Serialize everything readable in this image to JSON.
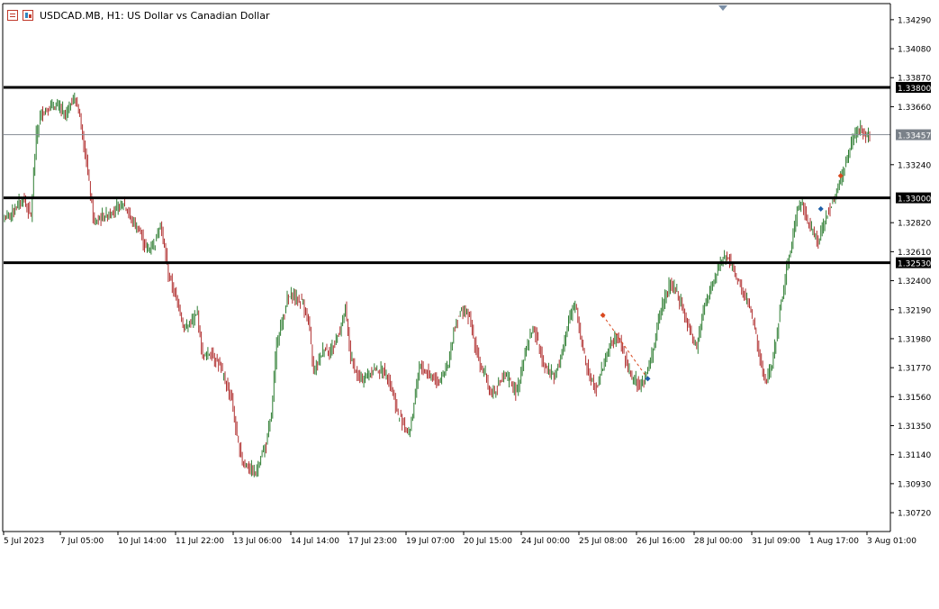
{
  "header": {
    "title": "USDCAD.MB, H1:  US Dollar vs Canadian Dollar",
    "chart_icon": "chart-window-icon",
    "trade_icon": "one-click-trading-icon"
  },
  "colors": {
    "bull": "#2e7d32",
    "bear": "#b03030",
    "axis": "#000000",
    "level_line": "#000000",
    "bid_line": "#8a9099",
    "bid_label_bg": "#7a8189",
    "buy_marker": "#d9481e",
    "sell_marker": "#1f5fa8",
    "background": "#ffffff"
  },
  "chart_data": {
    "type": "candlestick",
    "symbol": "USDCAD.MB",
    "timeframe": "H1",
    "ylim": [
      1.3059,
      1.344
    ],
    "y_ticks": [
      "1.34290",
      "1.34080",
      "1.33870",
      "1.33660",
      "1.33240",
      "1.32820",
      "1.32610",
      "1.32400",
      "1.32190",
      "1.31980",
      "1.31770",
      "1.31560",
      "1.31350",
      "1.31140",
      "1.30930",
      "1.30720"
    ],
    "x_ticks": [
      "5 Jul 2023",
      "7 Jul 05:00",
      "10 Jul 14:00",
      "11 Jul 22:00",
      "13 Jul 06:00",
      "14 Jul 14:00",
      "17 Jul 23:00",
      "19 Jul 07:00",
      "20 Jul 15:00",
      "24 Jul 00:00",
      "25 Jul 08:00",
      "26 Jul 16:00",
      "28 Jul 00:00",
      "31 Jul 09:00",
      "1 Aug 17:00",
      "3 Aug 01:00"
    ],
    "horizontal_levels": [
      {
        "price": 1.338,
        "label": "1.33800"
      },
      {
        "price": 1.33,
        "label": "1.33000"
      },
      {
        "price": 1.3253,
        "label": "1.32530"
      }
    ],
    "bid_line": {
      "price": 1.33457,
      "label": "1.33457"
    },
    "close_path": [
      [
        0,
        1.3285
      ],
      [
        8,
        1.3292
      ],
      [
        14,
        1.33
      ],
      [
        20,
        1.3287
      ],
      [
        24,
        1.3345
      ],
      [
        28,
        1.3362
      ],
      [
        34,
        1.3365
      ],
      [
        40,
        1.3367
      ],
      [
        46,
        1.336
      ],
      [
        52,
        1.3372
      ],
      [
        56,
        1.3365
      ],
      [
        60,
        1.334
      ],
      [
        64,
        1.331
      ],
      [
        68,
        1.328
      ],
      [
        72,
        1.3285
      ],
      [
        78,
        1.3288
      ],
      [
        84,
        1.3292
      ],
      [
        90,
        1.3296
      ],
      [
        96,
        1.3284
      ],
      [
        102,
        1.3276
      ],
      [
        108,
        1.3262
      ],
      [
        114,
        1.3268
      ],
      [
        118,
        1.3282
      ],
      [
        124,
        1.3245
      ],
      [
        128,
        1.3233
      ],
      [
        132,
        1.3222
      ],
      [
        136,
        1.3205
      ],
      [
        142,
        1.321
      ],
      [
        146,
        1.3216
      ],
      [
        150,
        1.3185
      ],
      [
        156,
        1.3188
      ],
      [
        162,
        1.318
      ],
      [
        166,
        1.317
      ],
      [
        172,
        1.3155
      ],
      [
        176,
        1.3125
      ],
      [
        180,
        1.311
      ],
      [
        186,
        1.3103
      ],
      [
        190,
        1.31
      ],
      [
        194,
        1.3112
      ],
      [
        198,
        1.3122
      ],
      [
        202,
        1.3142
      ],
      [
        206,
        1.3195
      ],
      [
        210,
        1.321
      ],
      [
        214,
        1.3226
      ],
      [
        218,
        1.323
      ],
      [
        222,
        1.3226
      ],
      [
        226,
        1.3224
      ],
      [
        230,
        1.321
      ],
      [
        234,
        1.3175
      ],
      [
        238,
        1.3183
      ],
      [
        242,
        1.3192
      ],
      [
        246,
        1.3188
      ],
      [
        250,
        1.3195
      ],
      [
        254,
        1.3205
      ],
      [
        258,
        1.322
      ],
      [
        262,
        1.3185
      ],
      [
        266,
        1.3173
      ],
      [
        270,
        1.3168
      ],
      [
        276,
        1.3172
      ],
      [
        280,
        1.3176
      ],
      [
        286,
        1.3175
      ],
      [
        290,
        1.3172
      ],
      [
        294,
        1.3158
      ],
      [
        298,
        1.3142
      ],
      [
        302,
        1.3138
      ],
      [
        306,
        1.3128
      ],
      [
        310,
        1.315
      ],
      [
        314,
        1.3178
      ],
      [
        318,
        1.3175
      ],
      [
        324,
        1.317
      ],
      [
        328,
        1.3168
      ],
      [
        332,
        1.3172
      ],
      [
        336,
        1.3178
      ],
      [
        340,
        1.3205
      ],
      [
        344,
        1.3215
      ],
      [
        348,
        1.322
      ],
      [
        352,
        1.3212
      ],
      [
        356,
        1.3195
      ],
      [
        360,
        1.3178
      ],
      [
        364,
        1.3172
      ],
      [
        368,
        1.3158
      ],
      [
        372,
        1.3162
      ],
      [
        376,
        1.3168
      ],
      [
        380,
        1.317
      ],
      [
        384,
        1.3165
      ],
      [
        388,
        1.3158
      ],
      [
        392,
        1.318
      ],
      [
        396,
        1.3195
      ],
      [
        400,
        1.3205
      ],
      [
        404,
        1.3195
      ],
      [
        408,
        1.318
      ],
      [
        412,
        1.3175
      ],
      [
        416,
        1.3172
      ],
      [
        420,
        1.318
      ],
      [
        424,
        1.3195
      ],
      [
        428,
        1.3215
      ],
      [
        432,
        1.3225
      ],
      [
        436,
        1.32
      ],
      [
        440,
        1.318
      ],
      [
        444,
        1.3168
      ],
      [
        448,
        1.3162
      ],
      [
        452,
        1.3175
      ],
      [
        456,
        1.3188
      ],
      [
        460,
        1.3195
      ],
      [
        464,
        1.32
      ],
      [
        468,
        1.319
      ],
      [
        472,
        1.3175
      ],
      [
        476,
        1.317
      ],
      [
        480,
        1.3165
      ],
      [
        484,
        1.3168
      ],
      [
        488,
        1.3178
      ],
      [
        492,
        1.3195
      ],
      [
        496,
        1.3215
      ],
      [
        500,
        1.3228
      ],
      [
        504,
        1.3238
      ],
      [
        508,
        1.3232
      ],
      [
        512,
        1.3225
      ],
      [
        516,
        1.321
      ],
      [
        520,
        1.32
      ],
      [
        524,
        1.319
      ],
      [
        528,
        1.3215
      ],
      [
        532,
        1.3228
      ],
      [
        536,
        1.3238
      ],
      [
        540,
        1.3246
      ],
      [
        544,
        1.3258
      ],
      [
        548,
        1.3255
      ],
      [
        552,
        1.3248
      ],
      [
        556,
        1.3238
      ],
      [
        560,
        1.3228
      ],
      [
        564,
        1.3222
      ],
      [
        568,
        1.3205
      ],
      [
        572,
        1.3182
      ],
      [
        576,
        1.3166
      ],
      [
        580,
        1.3175
      ],
      [
        584,
        1.3196
      ],
      [
        588,
        1.3225
      ],
      [
        592,
        1.3248
      ],
      [
        596,
        1.3268
      ],
      [
        600,
        1.329
      ],
      [
        604,
        1.3298
      ],
      [
        608,
        1.3282
      ],
      [
        612,
        1.3275
      ],
      [
        616,
        1.3268
      ],
      [
        620,
        1.328
      ],
      [
        624,
        1.3292
      ],
      [
        628,
        1.33
      ],
      [
        632,
        1.3312
      ],
      [
        636,
        1.3322
      ],
      [
        640,
        1.3336
      ],
      [
        644,
        1.3346
      ],
      [
        648,
        1.335
      ],
      [
        652,
        1.3344
      ],
      [
        655,
        1.3346
      ]
    ],
    "trade_markers": [
      {
        "type": "sell",
        "price": 1.3215,
        "bar": 453
      },
      {
        "type": "buy",
        "price": 1.3169,
        "bar": 487
      },
      {
        "type": "buy",
        "price": 1.3292,
        "bar": 618
      },
      {
        "type": "sell",
        "price": 1.3316,
        "bar": 633
      }
    ]
  }
}
